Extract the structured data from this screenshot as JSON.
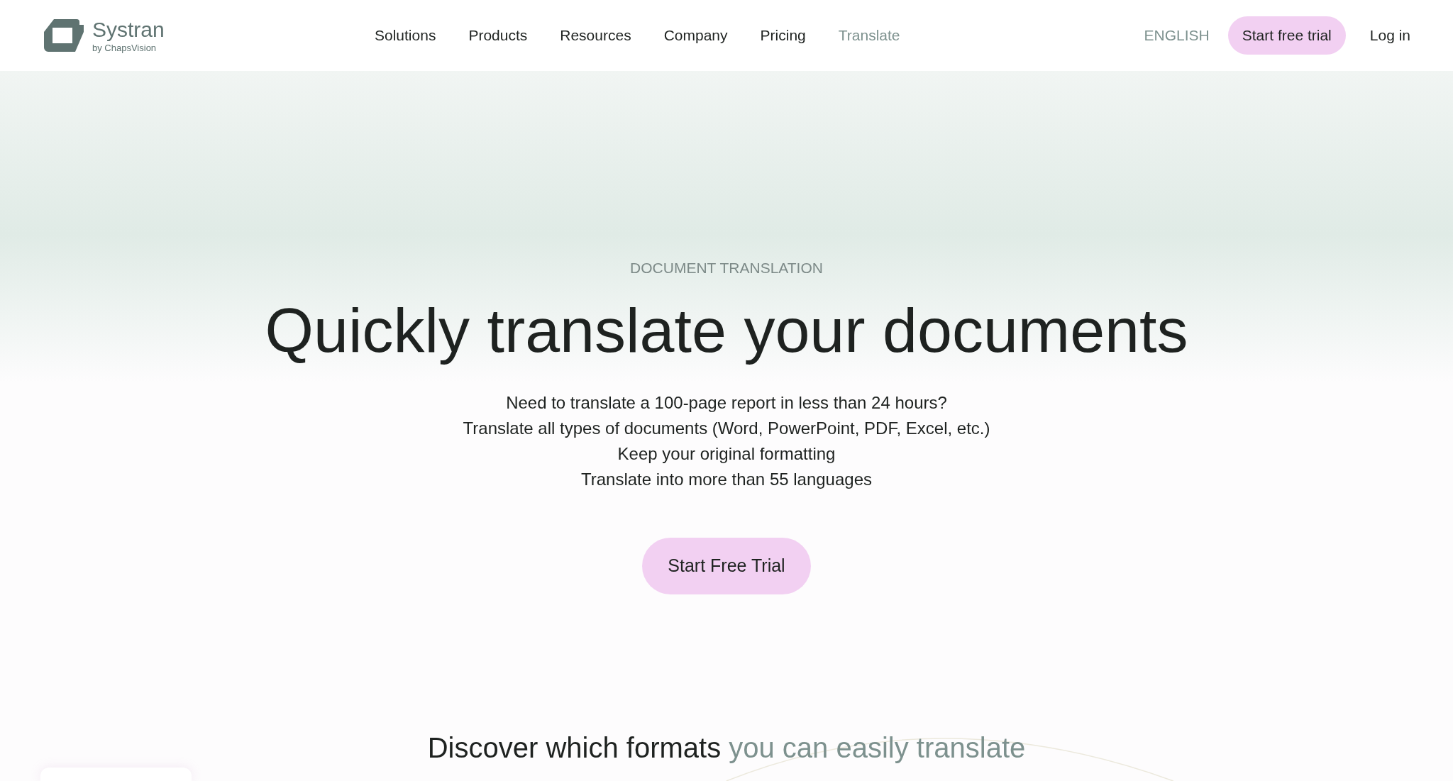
{
  "header": {
    "logo": {
      "name": "Systran",
      "tagline": "by ChapsVision"
    },
    "nav": [
      {
        "label": "Solutions",
        "selected": false
      },
      {
        "label": "Products",
        "selected": false
      },
      {
        "label": "Resources",
        "selected": false
      },
      {
        "label": "Company",
        "selected": false
      },
      {
        "label": "Pricing",
        "selected": false
      },
      {
        "label": "Translate",
        "selected": true
      }
    ],
    "language": "ENGLISH",
    "trial_button": "Start free trial",
    "login": "Log in"
  },
  "hero": {
    "eyebrow": "DOCUMENT TRANSLATION",
    "title": "Quickly translate your documents",
    "lines": [
      "Need to translate a 100-page report in less than 24 hours?",
      "Translate all types of documents (Word, PowerPoint, PDF, Excel, etc.)",
      "Keep your original formatting",
      "Translate into more than 55 languages"
    ],
    "cta": "Start Free Trial"
  },
  "formats": {
    "title": "Discover which formats",
    "title_highlight": "you can easily translate"
  }
}
